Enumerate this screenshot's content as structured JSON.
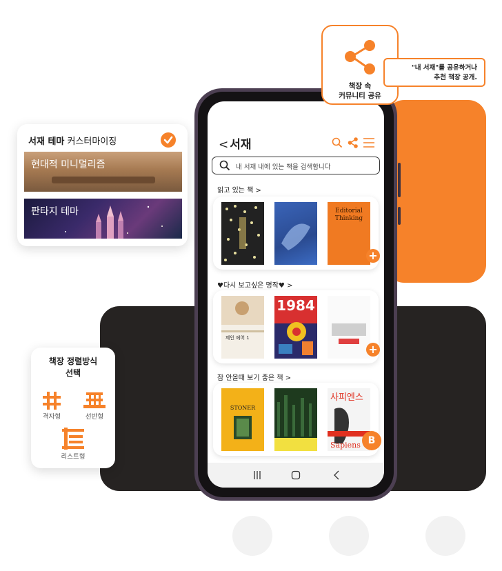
{
  "share_callout": {
    "label_line1": "책장 속",
    "label_line2": "커뮤니티 공유",
    "tip_line1": "\"내 서재\"를 공유하거나",
    "tip_line2": "추천 책장 공개."
  },
  "theme_card": {
    "title_bold": "서재 테마",
    "title_rest": " 커스터마이징",
    "themes": [
      "현대적 미니멀리즘",
      "판타지 테마"
    ]
  },
  "layout_card": {
    "title_line1": "책장 정렬방식",
    "title_line2": "선택",
    "options": [
      "격자형",
      "선반형",
      "리스트형"
    ]
  },
  "app": {
    "back": "<",
    "title": "서재",
    "search_placeholder": "내 서재 내에 있는 책을 검색합니다",
    "sections": [
      {
        "title": "읽고 있는 책 >"
      },
      {
        "title": "♥다시 보고싶은 명작♥ >"
      },
      {
        "title": "잠 안올때 보기 좋은 책 >"
      }
    ],
    "books": {
      "b2_title_line1": "Editorial",
      "b2_title_line2": "Thinking",
      "b3_title": "1984",
      "b4_title": "제인 에어 1",
      "b6_title": "STONER",
      "b8_title": "사피엔스",
      "b8_sub": "Sapiens"
    }
  },
  "colors": {
    "accent": "#f6822a",
    "dark": "#262322",
    "phone": "#4c3f52"
  },
  "icons": [
    "share-icon",
    "check-icon",
    "search-icon",
    "menu-icon",
    "grid-icon",
    "shelf-icon",
    "list-icon",
    "plus-icon"
  ]
}
